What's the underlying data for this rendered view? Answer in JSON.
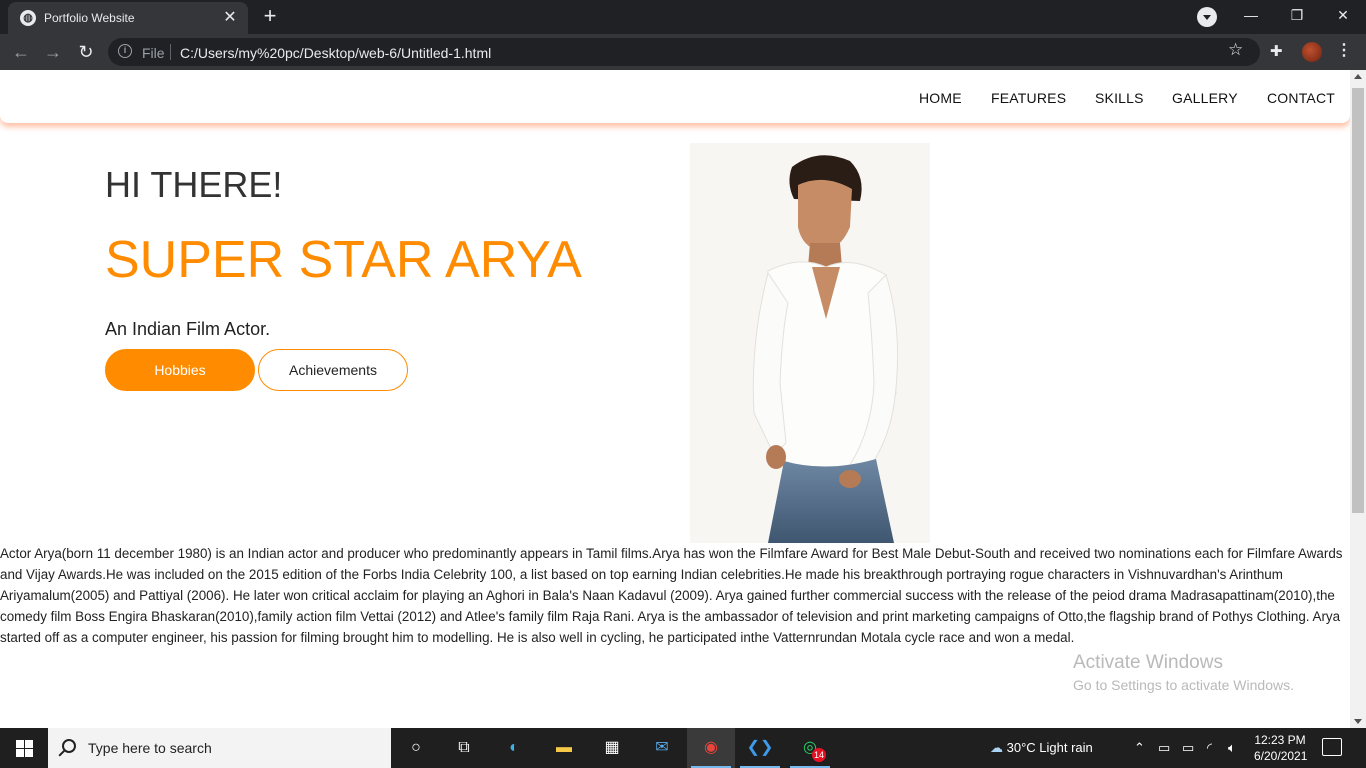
{
  "browser": {
    "tab_title": "Portfolio Website",
    "tab_close": "✕",
    "new_tab": "+",
    "file_label": "File",
    "url": "C:/Users/my%20pc/Desktop/web-6/Untitled-1.html",
    "window_minimize": "—",
    "window_restore": "❐",
    "window_close": "✕"
  },
  "nav": {
    "items": [
      "HOME",
      "FEATURES",
      "SKILLS",
      "GALLERY",
      "CONTACT"
    ]
  },
  "hero": {
    "greeting": "HI THERE!",
    "name": "SUPER STAR ARYA",
    "tagline": "An Indian Film Actor.",
    "buttons": {
      "hobbies": "Hobbies",
      "achievements": "Achievements"
    }
  },
  "bio": "Actor Arya(born 11 december 1980) is an Indian actor and producer who predominantly appears in Tamil films.Arya has won the Filmfare Award for Best Male Debut-South and received two nominations each for Filmfare Awards and Vijay Awards.He was included on the 2015 edition of the Forbs India Celebrity 100, a list based on top earning Indian celebrities.He made his breakthrough portraying rogue characters in Vishnuvardhan's Arinthum Ariyamalum(2005) and Pattiyal (2006). He later won critical acclaim for playing an Aghori in Bala's Naan Kadavul (2009). Arya gained further commercial success with the release of the peiod drama Madrasapattinam(2010),the comedy film Boss Engira Bhaskaran(2010),family action film Vettai (2012) and Atlee's family film Raja Rani. Arya is the ambassador of television and print marketing campaigns of Otto,the flagship brand of Pothys Clothing. Arya started off as a computer engineer, his passion for filming brought him to modelling. He is also well in cycling, he participated inthe Vatternrundan Motala cycle race and won a medal.",
  "watermark": {
    "line1": "Activate Windows",
    "line2": "Go to Settings to activate Windows."
  },
  "taskbar": {
    "search_placeholder": "Type here to search",
    "whatsapp_badge": "14",
    "weather": "30°C  Light rain",
    "time": "12:23 PM",
    "date": "6/20/2021"
  },
  "colors": {
    "accent": "#ff8c00",
    "nav_shadow": "#ff7a3c",
    "browser_dark": "#202124"
  }
}
